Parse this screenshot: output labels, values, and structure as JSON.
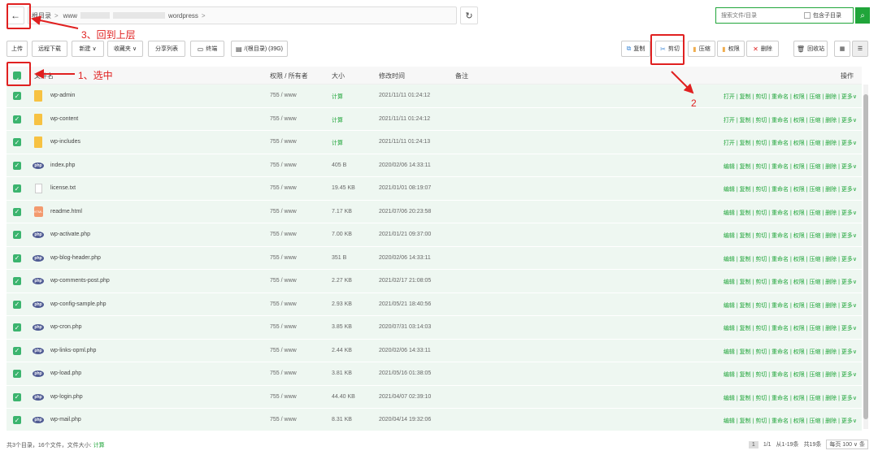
{
  "pathbar": {
    "back_glyph": "←",
    "segments": [
      "根目录",
      "www",
      "wordpress"
    ],
    "separator": ">",
    "refresh_glyph": "↻",
    "search_placeholder": "搜索文件/目录",
    "include_subdir_label": "包含子目录",
    "search_glyph": "⌕"
  },
  "toolbar": {
    "upload": "上传",
    "remote_download": "远程下载",
    "new": "新建",
    "favorites": "收藏夹",
    "share_list": "分享列表",
    "terminal": "终端",
    "disk": "/(根目录) (39G)",
    "copy": "复制",
    "cut": "剪切",
    "compress": "压缩",
    "permission": "权限",
    "delete": "删除",
    "recycle": "回收站"
  },
  "table": {
    "headers": {
      "name": "文件名",
      "perm": "权限 / 所有者",
      "size": "大小",
      "mtime": "修改时间",
      "note": "备注",
      "ops": "操作"
    },
    "rows": [
      {
        "type": "folder",
        "name": "wp-admin",
        "perm": "755 / www",
        "size": "计算",
        "mtime": "2021/11/11 01:24:12",
        "ops": "打开 | 复制 | 剪切 | 重命名 | 权限 | 压缩 | 删除 | 更多∨"
      },
      {
        "type": "folder",
        "name": "wp-content",
        "perm": "755 / www",
        "size": "计算",
        "mtime": "2021/11/11 01:24:12",
        "ops": "打开 | 复制 | 剪切 | 重命名 | 权限 | 压缩 | 删除 | 更多∨"
      },
      {
        "type": "folder",
        "name": "wp-includes",
        "perm": "755 / www",
        "size": "计算",
        "mtime": "2021/11/11 01:24:13",
        "ops": "打开 | 复制 | 剪切 | 重命名 | 权限 | 压缩 | 删除 | 更多∨"
      },
      {
        "type": "php",
        "name": "index.php",
        "perm": "755 / www",
        "size": "405 B",
        "mtime": "2020/02/06 14:33:11",
        "ops": "编辑 | 复制 | 剪切 | 重命名 | 权限 | 压缩 | 删除 | 更多∨"
      },
      {
        "type": "txt",
        "name": "license.txt",
        "perm": "755 / www",
        "size": "19.45 KB",
        "mtime": "2021/01/01 08:19:07",
        "ops": "编辑 | 复制 | 剪切 | 重命名 | 权限 | 压缩 | 删除 | 更多∨"
      },
      {
        "type": "html",
        "name": "readme.html",
        "perm": "755 / www",
        "size": "7.17 KB",
        "mtime": "2021/07/06 20:23:58",
        "ops": "编辑 | 复制 | 剪切 | 重命名 | 权限 | 压缩 | 删除 | 更多∨"
      },
      {
        "type": "php",
        "name": "wp-activate.php",
        "perm": "755 / www",
        "size": "7.00 KB",
        "mtime": "2021/01/21 09:37:00",
        "ops": "编辑 | 复制 | 剪切 | 重命名 | 权限 | 压缩 | 删除 | 更多∨"
      },
      {
        "type": "php",
        "name": "wp-blog-header.php",
        "perm": "755 / www",
        "size": "351 B",
        "mtime": "2020/02/06 14:33:11",
        "ops": "编辑 | 复制 | 剪切 | 重命名 | 权限 | 压缩 | 删除 | 更多∨"
      },
      {
        "type": "php",
        "name": "wp-comments-post.php",
        "perm": "755 / www",
        "size": "2.27 KB",
        "mtime": "2021/02/17 21:08:05",
        "ops": "编辑 | 复制 | 剪切 | 重命名 | 权限 | 压缩 | 删除 | 更多∨"
      },
      {
        "type": "php",
        "name": "wp-config-sample.php",
        "perm": "755 / www",
        "size": "2.93 KB",
        "mtime": "2021/05/21 18:40:56",
        "ops": "编辑 | 复制 | 剪切 | 重命名 | 权限 | 压缩 | 删除 | 更多∨"
      },
      {
        "type": "php",
        "name": "wp-cron.php",
        "perm": "755 / www",
        "size": "3.85 KB",
        "mtime": "2020/07/31 03:14:03",
        "ops": "编辑 | 复制 | 剪切 | 重命名 | 权限 | 压缩 | 删除 | 更多∨"
      },
      {
        "type": "php",
        "name": "wp-links-opml.php",
        "perm": "755 / www",
        "size": "2.44 KB",
        "mtime": "2020/02/06 14:33:11",
        "ops": "编辑 | 复制 | 剪切 | 重命名 | 权限 | 压缩 | 删除 | 更多∨"
      },
      {
        "type": "php",
        "name": "wp-load.php",
        "perm": "755 / www",
        "size": "3.81 KB",
        "mtime": "2021/05/16 01:38:05",
        "ops": "编辑 | 复制 | 剪切 | 重命名 | 权限 | 压缩 | 删除 | 更多∨"
      },
      {
        "type": "php",
        "name": "wp-login.php",
        "perm": "755 / www",
        "size": "44.40 KB",
        "mtime": "2021/04/07 02:39:10",
        "ops": "编辑 | 复制 | 剪切 | 重命名 | 权限 | 压缩 | 删除 | 更多∨"
      },
      {
        "type": "php",
        "name": "wp-mail.php",
        "perm": "755 / www",
        "size": "8.31 KB",
        "mtime": "2020/04/14 19:32:06",
        "ops": "编辑 | 复制 | 剪切 | 重命名 | 权限 | 压缩 | 删除 | 更多∨"
      }
    ]
  },
  "footer": {
    "summary": "共3个目录，16个文件，文件大小:",
    "summary_calc": "计算",
    "page_current": "1",
    "page_info": "1/1",
    "range": "从1-19条",
    "total": "共19条",
    "per_page": "每页 100 ∨ 条"
  },
  "annotations": {
    "step1": "1、选中",
    "step2": "2",
    "step3": "3、回到上层"
  },
  "colors": {
    "accent": "#20a53a",
    "row_bg": "#eef7f1",
    "checkbox": "#3bb46e",
    "annotation": "#e02020"
  }
}
